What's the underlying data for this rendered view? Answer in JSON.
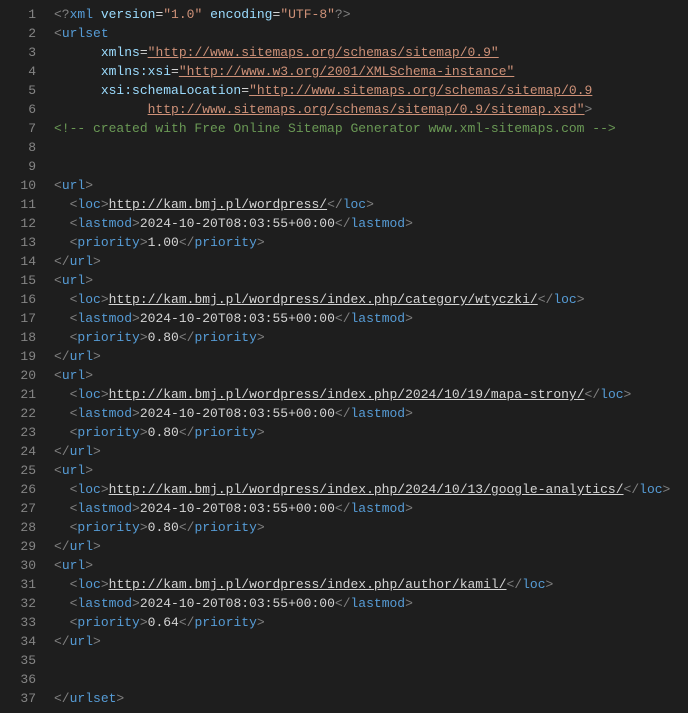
{
  "xml_decl": {
    "version_attr": "version",
    "version_val": "\"1.0\"",
    "encoding_attr": "encoding",
    "encoding_val": "\"UTF-8\""
  },
  "urlset": {
    "tag": "urlset",
    "xmlns_attr": "xmlns",
    "xmlns_val": "\"http://www.sitemaps.org/schemas/sitemap/0.9\"",
    "xsi_attr": "xmlns:xsi",
    "xsi_val": "\"http://www.w3.org/2001/XMLSchema-instance\"",
    "schema_attr": "xsi:schemaLocation",
    "schema_val1": "\"http://www.sitemaps.org/schemas/sitemap/0.9",
    "schema_val2": "http://www.sitemaps.org/schemas/sitemap/0.9/sitemap.xsd\""
  },
  "comment": "<!-- created with Free Online Sitemap Generator www.xml-sitemaps.com -->",
  "tags": {
    "url": "url",
    "loc": "loc",
    "lastmod": "lastmod",
    "priority": "priority"
  },
  "entries": [
    {
      "loc": "http://kam.bmj.pl/wordpress/",
      "lastmod": "2024-10-20T08:03:55+00:00",
      "priority": "1.00"
    },
    {
      "loc": "http://kam.bmj.pl/wordpress/index.php/category/wtyczki/",
      "lastmod": "2024-10-20T08:03:55+00:00",
      "priority": "0.80"
    },
    {
      "loc": "http://kam.bmj.pl/wordpress/index.php/2024/10/19/mapa-strony/",
      "lastmod": "2024-10-20T08:03:55+00:00",
      "priority": "0.80"
    },
    {
      "loc": "http://kam.bmj.pl/wordpress/index.php/2024/10/13/google-analytics/",
      "lastmod": "2024-10-20T08:03:55+00:00",
      "priority": "0.80"
    },
    {
      "loc": "http://kam.bmj.pl/wordpress/index.php/author/kamil/",
      "lastmod": "2024-10-20T08:03:55+00:00",
      "priority": "0.64"
    }
  ],
  "line_numbers": [
    "1",
    "2",
    "3",
    "4",
    "5",
    "6",
    "7",
    "8",
    "9",
    "10",
    "11",
    "12",
    "13",
    "14",
    "15",
    "16",
    "17",
    "18",
    "19",
    "20",
    "21",
    "22",
    "23",
    "24",
    "25",
    "26",
    "27",
    "28",
    "29",
    "30",
    "31",
    "32",
    "33",
    "34",
    "35",
    "36",
    "37"
  ]
}
